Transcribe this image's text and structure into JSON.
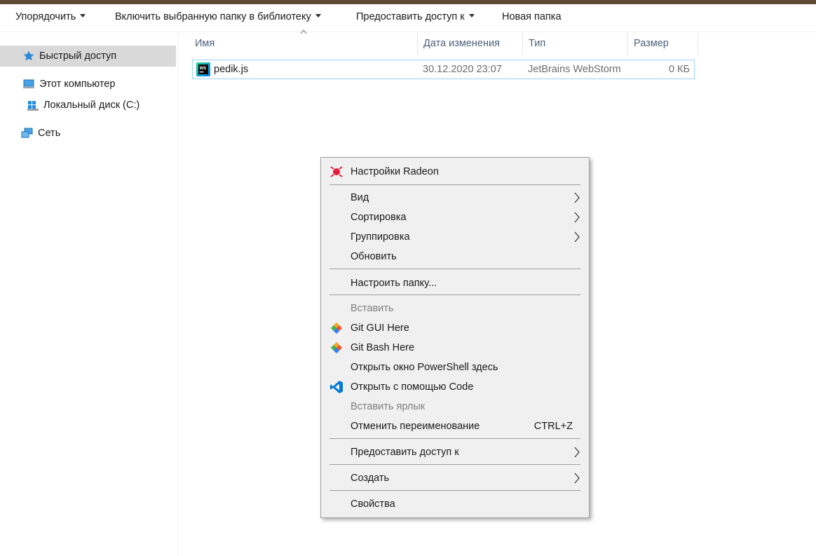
{
  "toolbar": {
    "organize": "Упорядочить",
    "include_library": "Включить выбранную папку в библиотеку",
    "share": "Предоставить доступ к",
    "new_folder": "Новая папка"
  },
  "sidebar": {
    "quick_access": "Быстрый доступ",
    "this_pc": "Этот компьютер",
    "local_disk": "Локальный диск (C:)",
    "network": "Сеть"
  },
  "columns": {
    "name": "Имя",
    "date": "Дата изменения",
    "type": "Тип",
    "size": "Размер"
  },
  "files": [
    {
      "name": "pedik.js",
      "date": "30.12.2020 23:07",
      "type": "JetBrains WebStorm",
      "size": "0 КБ",
      "icon": "webstorm-icon",
      "icon_text": "WS"
    }
  ],
  "context_menu": {
    "radeon": "Настройки Radeon",
    "view": "Вид",
    "sort": "Сортировка",
    "group": "Группировка",
    "refresh": "Обновить",
    "customize": "Настроить папку...",
    "paste": "Вставить",
    "git_gui": "Git GUI Here",
    "git_bash": "Git Bash Here",
    "powershell": "Открыть окно PowerShell здесь",
    "vscode": "Открыть с помощью Code",
    "paste_shortcut": "Вставить ярлык",
    "undo_rename": "Отменить переименование",
    "undo_shortcut": "CTRL+Z",
    "give_access": "Предоставить доступ к",
    "new": "Создать",
    "properties": "Свойства"
  },
  "colors": {
    "title_bar": "#5e4a35",
    "selection_border": "#99d1ff",
    "menu_bg": "#f0f0f0",
    "radeon_red": "#e0203a",
    "vscode_blue": "#0078d4"
  }
}
